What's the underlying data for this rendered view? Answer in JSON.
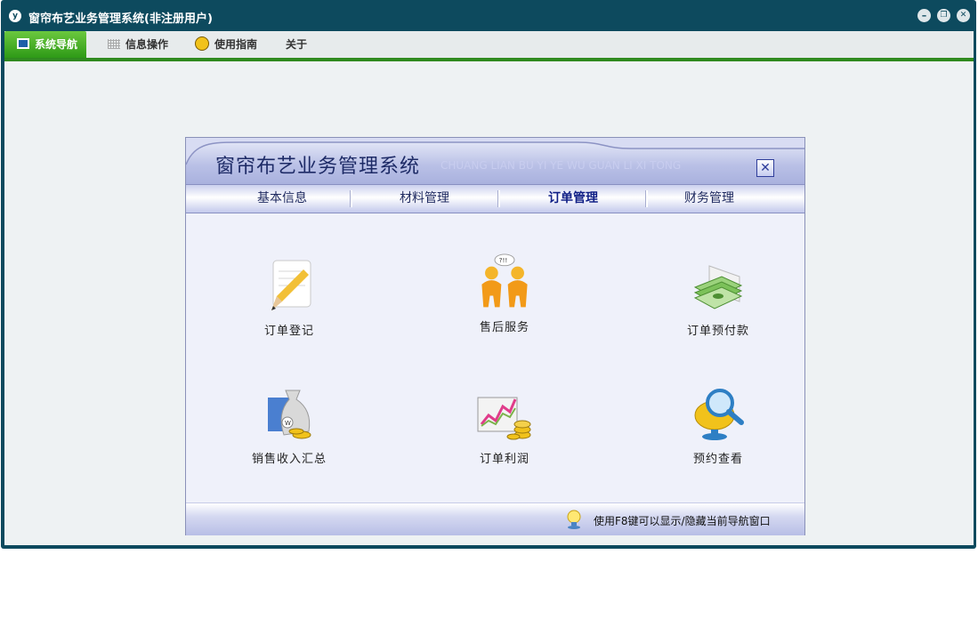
{
  "window": {
    "title": "窗帘布艺业务管理系统(非注册用户)",
    "app_icon_glyph": "y",
    "controls": {
      "minimize": "–",
      "restore": "❐",
      "close": "✕"
    }
  },
  "menubar": {
    "items": [
      {
        "label": "系统导航",
        "icon": "monitor-icon",
        "active": true
      },
      {
        "label": "信息操作",
        "icon": "grid-icon",
        "active": false
      },
      {
        "label": "使用指南",
        "icon": "compass-icon",
        "active": false
      },
      {
        "label": "关于",
        "icon": "",
        "active": false
      }
    ],
    "accent_color": "#2f8a1f"
  },
  "nav": {
    "title": "窗帘布艺业务管理系统",
    "subtitle": "CHUANG LIAN BU YI YE WU GUAN LI XI TONG",
    "close_glyph": "✕",
    "tabs": [
      {
        "label": "基本信息",
        "active": false
      },
      {
        "label": "材料管理",
        "active": false
      },
      {
        "label": "订单管理",
        "active": true
      },
      {
        "label": "财务管理",
        "active": false
      }
    ],
    "tiles": [
      {
        "label": "订单登记",
        "icon": "pencil-notepad-icon"
      },
      {
        "label": "售后服务",
        "icon": "people-question-icon"
      },
      {
        "label": "订单预付款",
        "icon": "money-bills-icon"
      },
      {
        "label": "销售收入汇总",
        "icon": "money-bag-icon"
      },
      {
        "label": "订单利润",
        "icon": "profit-chart-coins-icon"
      },
      {
        "label": "预约查看",
        "icon": "magnifier-monitor-icon"
      }
    ],
    "footer_hint": "使用F8键可以显示/隐藏当前导航窗口",
    "footer_icon": "lightbulb-icon"
  },
  "colors": {
    "frame": "#0d4a5e",
    "menu_active": "#3aa620",
    "nav_header": "#b9c0e6",
    "nav_body": "#eff1fa"
  }
}
